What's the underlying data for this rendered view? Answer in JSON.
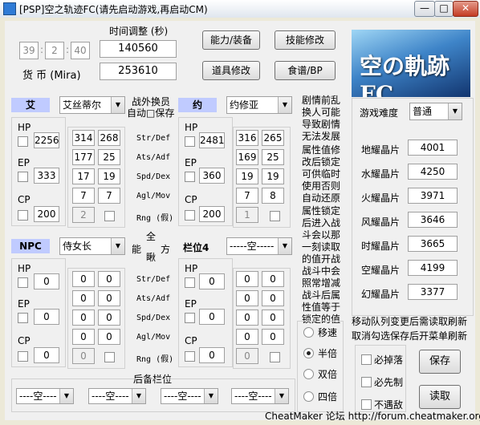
{
  "window": {
    "title": "[PSP]空之轨迹FC(请先启动游戏,再启动CM)",
    "min": "—",
    "max": "□",
    "close": "✕"
  },
  "time": {
    "label": "时间调整 (秒)",
    "h": "39",
    "m": "2",
    "s": "40",
    "value": "140560"
  },
  "money": {
    "label": "货  币 (Mira)",
    "value": "253610"
  },
  "buttons": {
    "ability": "能力/装备",
    "skill": "技能修改",
    "item": "道具修改",
    "food": "食谱/BP",
    "save": "保存",
    "read": "读取"
  },
  "party": {
    "slot1_tag": "艾",
    "slot1_name": "艾丝蒂尔",
    "slot2_tag": "约",
    "slot2_name": "约修亚",
    "outside_label": "战外换员",
    "auto_save_label": "自动□保存",
    "npc_tag": "NPC",
    "npc_name": "侍女长",
    "ability_label": "能",
    "full_label": "全",
    "void_label": "瞅",
    "square_label": "方",
    "slot4_tag": "栏位4",
    "slot4_name": "-----空-----",
    "reserve_label": "后备栏位",
    "reserve_slots": [
      "----空----",
      "----空----",
      "----空----",
      "----空----"
    ]
  },
  "stats_labels": [
    "Str/Def",
    "Ats/Adf",
    "Spd/Dex",
    "Agl/Mov",
    "Rng (假)"
  ],
  "stats_labels2": [
    "Str/Def",
    "Ats/Adf",
    "Spd/Dex",
    "Agl/Mov",
    "Rng (假)"
  ],
  "char1": {
    "hp": "2256",
    "ep": "333",
    "cp": "200",
    "str": "314",
    "def": "268",
    "ats": "177",
    "adf": "25",
    "spd": "17",
    "dex": "19",
    "agl": "7",
    "mov": "7",
    "rng": "2"
  },
  "char2": {
    "hp": "2481",
    "ep": "360",
    "cp": "200",
    "str": "316",
    "def": "265",
    "ats": "169",
    "adf": "25",
    "spd": "19",
    "dex": "19",
    "agl": "7",
    "mov": "8",
    "rng": "1"
  },
  "char3": {
    "hp": "0",
    "ep": "0",
    "cp": "0",
    "str": "0",
    "def": "0",
    "ats": "0",
    "adf": "0",
    "spd": "0",
    "dex": "0",
    "agl": "0",
    "mov": "0",
    "rng": "0"
  },
  "char4": {
    "hp": "0",
    "ep": "0",
    "cp": "0",
    "str": "0",
    "def": "0",
    "ats": "0",
    "adf": "0",
    "spd": "0",
    "dex": "0",
    "agl": "0",
    "mov": "0",
    "rng": "0"
  },
  "labels": {
    "hp": "HP",
    "ep": "EP",
    "cp": "CP"
  },
  "notes": {
    "n1": "剧情前乱换人可能导致剧情无法发展",
    "n2": "属性值修改后锁定可供临时使用否则自动还原",
    "n3": "属性锁定后进入战斗会以那一刻读取的值开战战斗中会照常增减战斗后属性值等于锁定的值"
  },
  "difficulty": {
    "label": "游戏难度",
    "value": "普通"
  },
  "crystals": [
    {
      "name": "地耀晶片",
      "value": "4001"
    },
    {
      "name": "水耀晶片",
      "value": "4250"
    },
    {
      "name": "火耀晶片",
      "value": "3971"
    },
    {
      "name": "风耀晶片",
      "value": "3646"
    },
    {
      "name": "时耀晶片",
      "value": "3665"
    },
    {
      "name": "空耀晶片",
      "value": "4199"
    },
    {
      "name": "幻耀晶片",
      "value": "3377"
    }
  ],
  "hint": "移动队列变更后需读取刷新取消勾选保存后开菜单刷新",
  "speed": [
    "移速",
    "半倍",
    "双倍",
    "四倍"
  ],
  "checks": [
    "必掉落",
    "必先制",
    "不遇敌"
  ],
  "banner_text": "空の軌跡FC",
  "footer": "CheatMaker 论坛 http://forum.cheatmaker.org/"
}
